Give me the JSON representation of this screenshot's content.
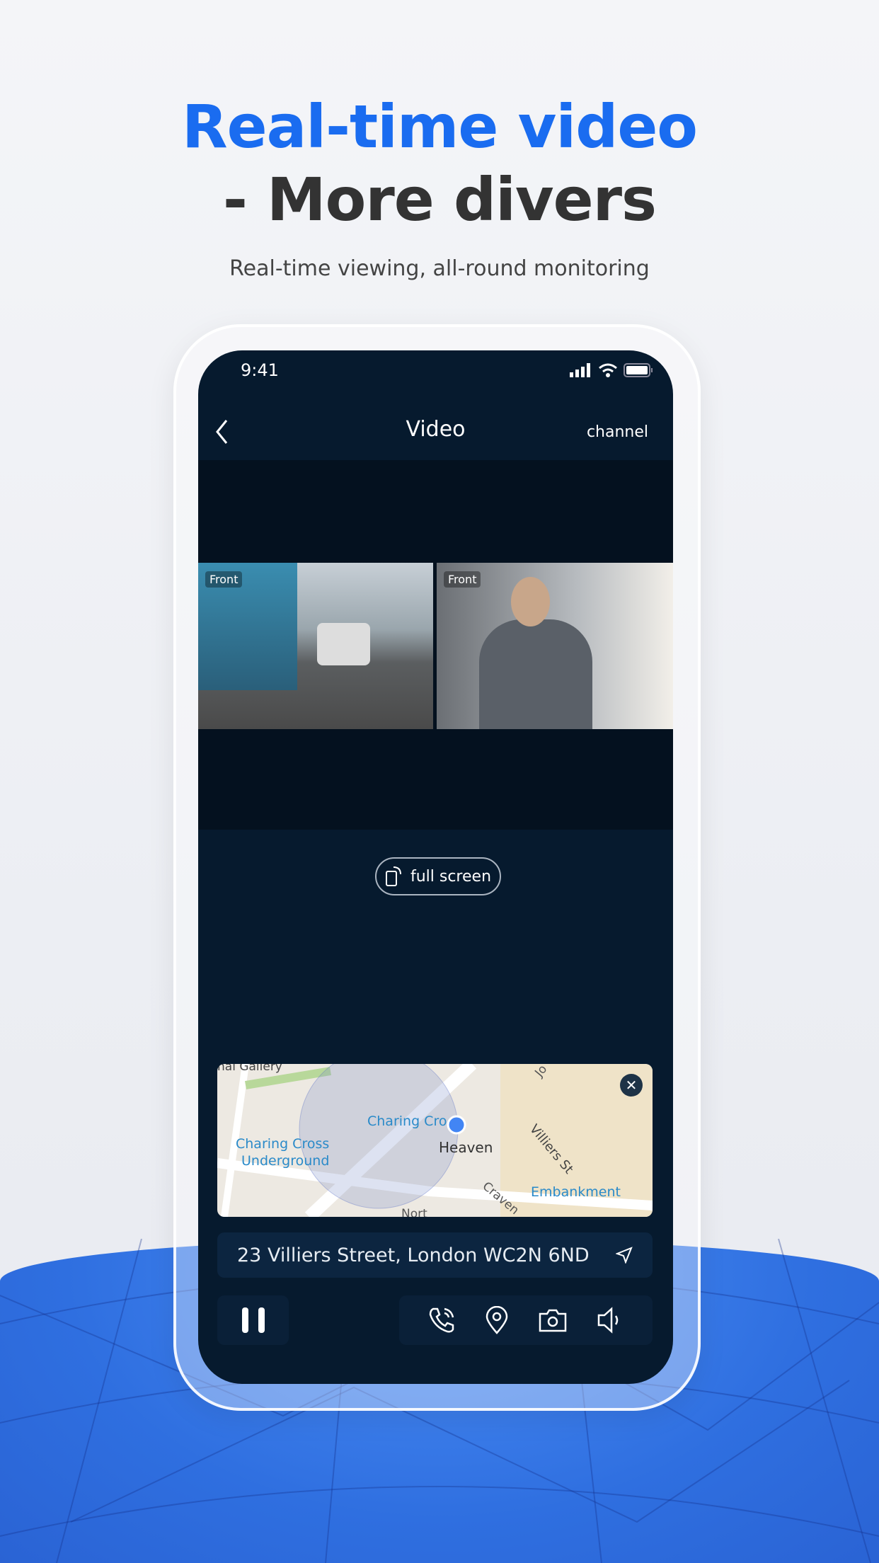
{
  "headline": {
    "line1": "Real-time video",
    "line2": "- More divers",
    "subtitle": "Real-time viewing, all-round monitoring",
    "accent": "#1a6cf0"
  },
  "status_bar": {
    "time": "9:41"
  },
  "nav": {
    "title": "Video",
    "channel": "channel"
  },
  "videos": [
    {
      "label": "Front"
    },
    {
      "label": "Front"
    }
  ],
  "full_screen_label": "full screen",
  "map": {
    "labels": [
      "nal Gallery",
      "Charing Cro",
      "Charing Cross",
      "Underground",
      "Heaven",
      "Villiers St",
      "Embankment",
      "Craven",
      "Nort",
      "Jo"
    ]
  },
  "address": "23 Villiers Street, London WC2N 6ND",
  "controls": [
    "pause-icon",
    "phone-icon",
    "location-pin-icon",
    "camera-icon",
    "speaker-icon"
  ]
}
